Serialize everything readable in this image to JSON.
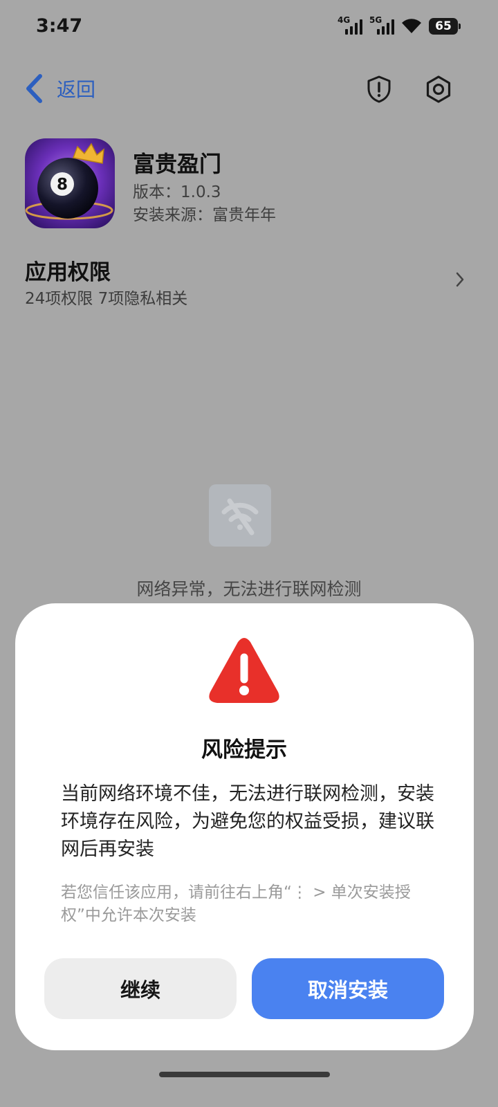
{
  "status_bar": {
    "time": "3:47",
    "signal1_label": "4G",
    "signal2_label": "5G",
    "battery": "65",
    "icons": [
      "signal-4g-icon",
      "signal-5g-icon",
      "wifi-icon",
      "battery-icon"
    ]
  },
  "header": {
    "back_label": "返回",
    "icons": [
      "shield-alert-icon",
      "settings-gear-icon"
    ]
  },
  "app": {
    "name": "富贵盈门",
    "version": "版本：1.0.3",
    "source": "安装来源：富贵年年"
  },
  "permissions": {
    "title": "应用权限",
    "summary": "24项权限 7项隐私相关"
  },
  "network": {
    "message": "网络异常，无法进行联网检测"
  },
  "dialog": {
    "title": "风险提示",
    "body": "当前网络环境不佳，无法进行联网检测，安装环境存在风险，为避免您的权益受损，建议联网后再安装",
    "hint": "若您信任该应用，请前往右上角“⋮ > 单次安装授权”中允许本次安装",
    "continue_label": "继续",
    "cancel_label": "取消安装"
  },
  "colors": {
    "accent_blue": "#4a82f0",
    "warning_red": "#e8302a",
    "dim_background": "#a7a7a7",
    "back_link": "#2c5fbf"
  }
}
